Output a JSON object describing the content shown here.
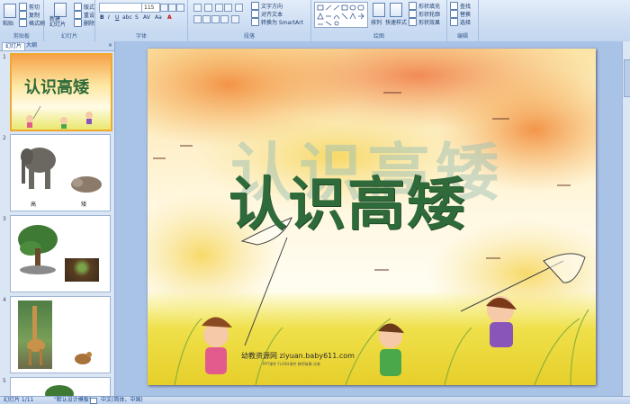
{
  "ribbon": {
    "clipboard": {
      "paste": "粘贴",
      "cut": "剪切",
      "copy": "复制",
      "format_painter": "格式刷",
      "label": "剪贴板"
    },
    "slides": {
      "new_slide": "新建\n幻灯片",
      "layout": "版式",
      "reset": "重设",
      "delete": "删除",
      "label": "幻灯片"
    },
    "font": {
      "font_size": "115",
      "label": "字体"
    },
    "paragraph": {
      "text_direction": "文字方向",
      "align_text": "对齐文本",
      "smartart": "转换为 SmartArt",
      "label": "段落"
    },
    "drawing": {
      "arrange": "排列",
      "quick_styles": "快速样式",
      "fill": "形状填充",
      "outline": "形状轮廓",
      "effects": "形状效果",
      "label": "绘图"
    },
    "editing": {
      "find": "查找",
      "replace": "替换",
      "select": "选择",
      "label": "编辑"
    }
  },
  "panel": {
    "tab_slides": "幻灯片",
    "tab_outline": "大纲",
    "close": "×",
    "slide_numbers": [
      "1",
      "2",
      "3",
      "4",
      "5"
    ],
    "thumb1_title": "认识高矮",
    "thumb2_labels": [
      "高",
      "矮"
    ]
  },
  "slide": {
    "title": "认识高矮",
    "watermark": "幼教资源网 ziyuan.baby611.com",
    "footer_small": "PPT课件   FLASH课件   教师故事   试卷"
  },
  "status": {
    "slide_count": "幻灯片 1/11",
    "theme": "\"默认设计模板\"",
    "language": "中文(简体，中国)"
  },
  "colors": {
    "title_green": "#2f6b3a",
    "ribbon_blue": "#15428b",
    "selected_border": "#f0a830"
  }
}
